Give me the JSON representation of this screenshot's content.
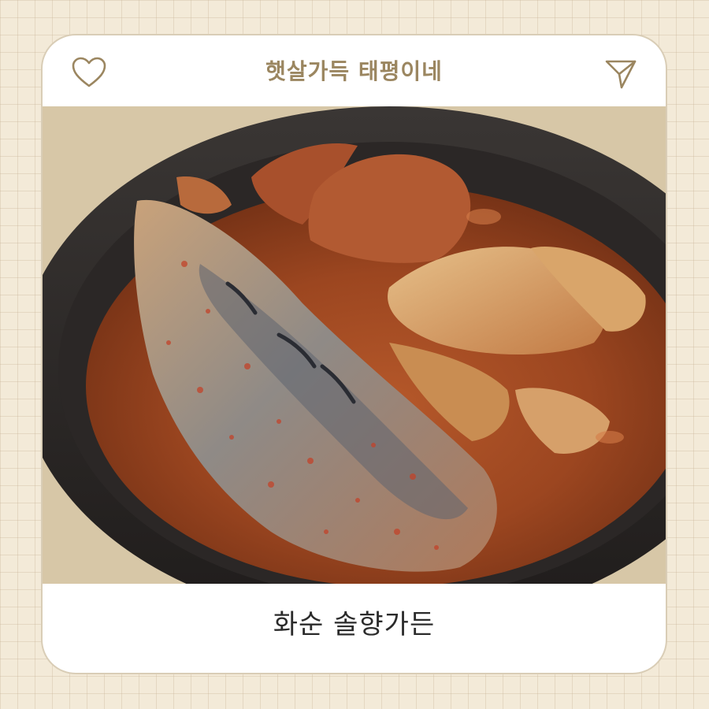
{
  "header": {
    "title": "햇살가득 태평이네",
    "like_icon": "heart-icon",
    "share_icon": "send-icon"
  },
  "photo": {
    "subject": "braised mackerel with kimchi and radish in a black clay pot"
  },
  "caption": {
    "text": "화순 솔향가든"
  },
  "colors": {
    "background": "#f3ead8",
    "card_border": "#d9cdb6",
    "title": "#9b8660",
    "icon": "#9b8660",
    "caption": "#2b2b2b"
  }
}
